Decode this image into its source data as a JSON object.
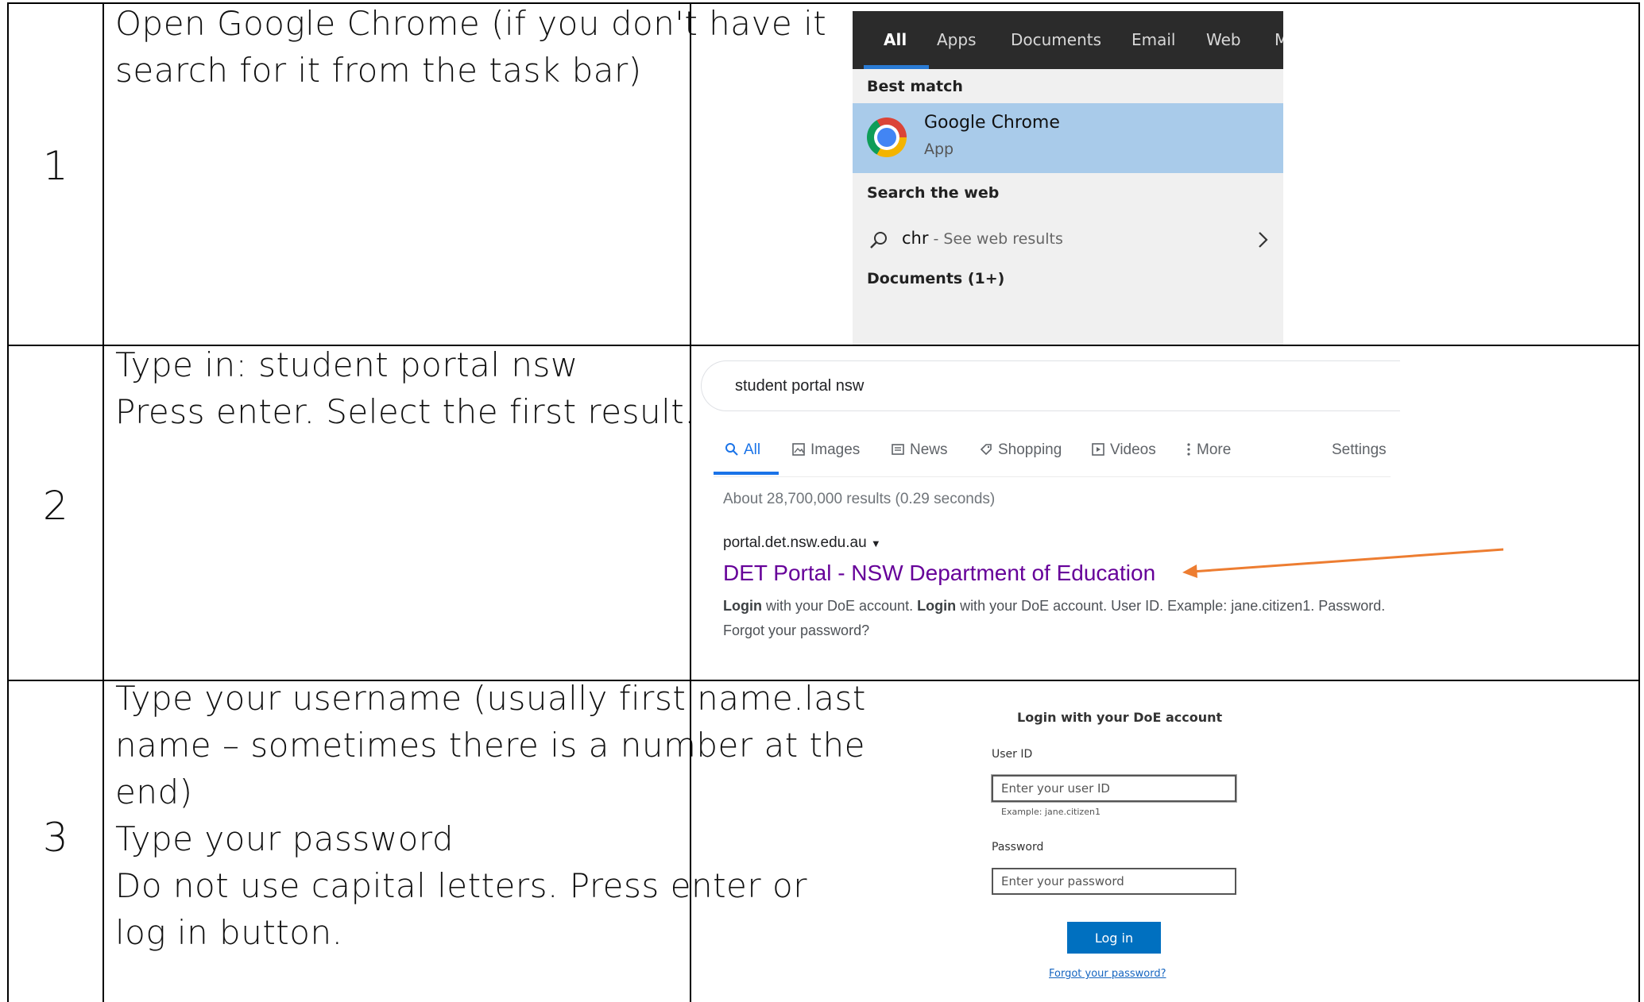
{
  "rows": [
    {
      "number": "1",
      "instruction": "Open Google Chrome (if you don't have it\nsearch for it from the task bar)"
    },
    {
      "number": "2",
      "instruction": "Type in: student portal nsw\nPress enter. Select the first result."
    },
    {
      "number": "3",
      "instruction": "Type your username (usually first name.last\nname – sometimes there is a number at the\nend)\nType your password\nDo not use capital letters. Press enter or\nlog in button."
    }
  ],
  "windows_search": {
    "tabs": [
      "All",
      "Apps",
      "Documents",
      "Email",
      "Web",
      "M"
    ],
    "best_match_heading": "Best match",
    "app_name": "Google Chrome",
    "app_type": "App",
    "search_web_heading": "Search the web",
    "query": "chr",
    "web_suffix": " - See web results",
    "documents_heading": "Documents (1+)",
    "accent_color": "#2a7bd4"
  },
  "google": {
    "query": "student portal nsw",
    "tabs": {
      "all": "All",
      "images": "Images",
      "news": "News",
      "shopping": "Shopping",
      "videos": "Videos",
      "more": "More",
      "settings": "Settings"
    },
    "stats": "About 28,700,000 results (0.29 seconds)",
    "result": {
      "url": "portal.det.nsw.edu.au",
      "title": "DET Portal - NSW Department of Education",
      "snippet_bold_1": "Login",
      "snippet_text_1": " with your DoE account. ",
      "snippet_bold_2": "Login",
      "snippet_text_2": " with your DoE account. User ID. Example: jane.citizen1. Password. Forgot your password?"
    },
    "arrow_color": "#ed7d31"
  },
  "login": {
    "title": "Login with your DoE account",
    "user_label": "User ID",
    "user_placeholder": "Enter your user ID",
    "user_hint": "Example: jane.citizen1",
    "password_label": "Password",
    "password_placeholder": "Enter your password",
    "button": "Log in",
    "forgot": "Forgot your password?",
    "button_color": "#0070c0"
  }
}
